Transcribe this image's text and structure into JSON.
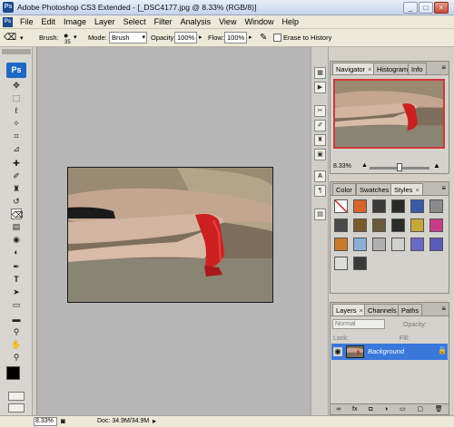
{
  "window": {
    "title": "Adobe Photoshop CS3 Extended - [_DSC4177.jpg @ 8.33% (RGB/8)]",
    "app_badge": "Ps",
    "controls": [
      "_",
      "□",
      "×"
    ]
  },
  "menubar": {
    "items": [
      "File",
      "Edit",
      "Image",
      "Layer",
      "Select",
      "Filter",
      "Analysis",
      "View",
      "Window",
      "Help"
    ]
  },
  "options": {
    "brush_label": "Brush:",
    "brush_size": "35",
    "mode_label": "Mode:",
    "mode_value": "Brush",
    "opacity_label": "Opacity:",
    "opacity_value": "100%",
    "flow_label": "Flow:",
    "flow_value": "100%",
    "erase_to_history": "Erase to History"
  },
  "toolbox": {
    "logo": "Ps",
    "tools": [
      "move-icon",
      "marquee-icon",
      "lasso-icon",
      "magic-wand-icon",
      "crop-icon",
      "slice-icon",
      "healing-icon",
      "brush-icon",
      "clone-stamp-icon",
      "history-brush-icon",
      "eraser-icon",
      "gradient-icon",
      "blur-icon",
      "dodge-icon",
      "pen-icon",
      "type-icon",
      "path-selection-icon",
      "shape-icon",
      "notes-icon",
      "eyedropper-icon",
      "hand-icon",
      "zoom-icon"
    ]
  },
  "status": {
    "zoom": "8.33%",
    "doc": "Doc: 34.9M/34.9M"
  },
  "navigator": {
    "tabs": [
      "Navigator",
      "Histogram",
      "Info"
    ],
    "zoom": "8.33%"
  },
  "styles_panel": {
    "tabs": [
      "Color",
      "Swatches",
      "Styles"
    ],
    "swatch_colors": [
      "#ffffff",
      "#d8642a",
      "#3a3a3a",
      "#2a2a2a",
      "#3a5aa8",
      "#8a8a8a",
      "#4a4a4a",
      "#7a5a2a",
      "#6a5a3a",
      "#2a2a2a",
      "#c8a83a",
      "#c83a8a",
      "#c87a2a",
      "#8ab0d8",
      "#b0b0b0",
      "#d0d0d0",
      "#6a6ac8",
      "#5a5ab8",
      "#dcdcd8",
      "#3a3a3a"
    ]
  },
  "layers_panel": {
    "tabs": [
      "Layers",
      "Channels",
      "Paths"
    ],
    "blend_mode": "Normal",
    "opacity_label": "Opacity:",
    "lock_label": "Lock:",
    "fill_label": "Fill:",
    "layer_name": "Background"
  }
}
